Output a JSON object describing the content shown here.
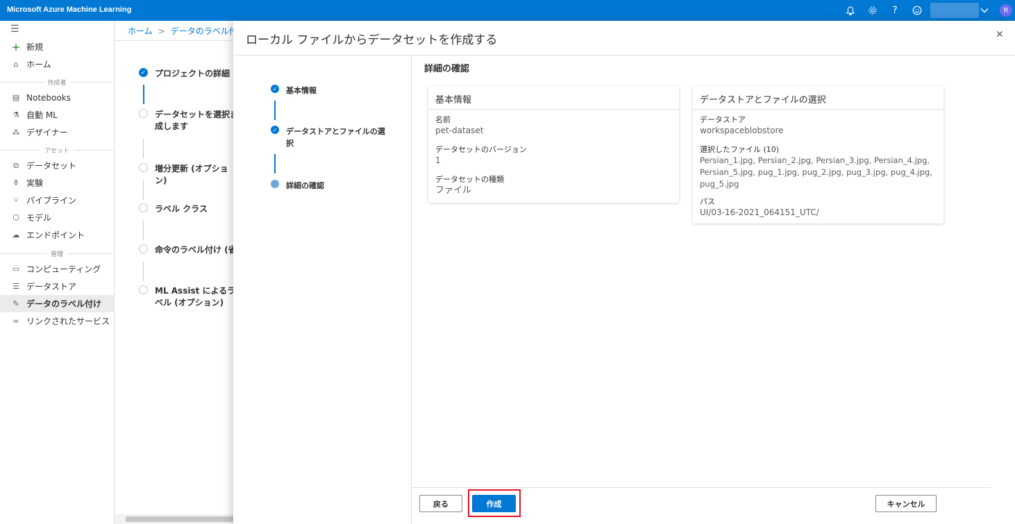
{
  "app": {
    "title": "Microsoft Azure Machine Learning",
    "topbar_icons": [
      "bell-icon",
      "gear-icon",
      "help-icon",
      "smiley-icon",
      "chevron-down-icon"
    ],
    "help_glyph": "?",
    "avatar_initial": "R",
    "colors": {
      "accent": "#0078d4",
      "highlight": "#e81123"
    }
  },
  "sidebar": {
    "new_label": "新規",
    "home_label": "ホーム",
    "section_author": "作成者",
    "notebooks_label": "Notebooks",
    "automl_label": "自動 ML",
    "designer_label": "デザイナー",
    "section_assets": "アセット",
    "datasets_label": "データセット",
    "experiments_label": "実験",
    "pipelines_label": "パイプライン",
    "models_label": "モデル",
    "endpoints_label": "エンドポイント",
    "section_manage": "管理",
    "compute_label": "コンピューティング",
    "datastores_label": "データストア",
    "labeling_label": "データのラベル付け",
    "linked_services_label": "リンクされたサービス"
  },
  "background": {
    "breadcrumb_home": "ホーム",
    "breadcrumb_sep": ">",
    "breadcrumb_current": "データのラベル付け",
    "steps": [
      "プロジェクトの詳細",
      "データセットを選択ま 成します",
      "増分更新 (オプション)",
      "ラベル クラス",
      "命令のラベル付け (省",
      "ML Assist によるラベル (オプション)"
    ]
  },
  "panel": {
    "title": "ローカル ファイルからデータセットを作成する",
    "close_glyph": "✕",
    "wizard_steps": [
      "基本情報",
      "データストアとファイルの選択",
      "詳細の確認"
    ],
    "review_title": "詳細の確認",
    "basic_card": {
      "title": "基本情報",
      "name_label": "名前",
      "name_value": "pet-dataset",
      "version_label": "データセットのバージョン",
      "version_value": "1",
      "type_label": "データセットの種類",
      "type_value": "ファイル"
    },
    "datastore_card": {
      "title": "データストアとファイルの選択",
      "datastore_label": "データストア",
      "datastore_value": "workspaceblobstore",
      "files_label": "選択したファイル (10)",
      "files_line1": "Persian_1.jpg, Persian_2.jpg, Persian_3.jpg, Persian_4.jpg,",
      "files_line2": "Persian_5.jpg, pug_1.jpg, pug_2.jpg, pug_3.jpg, pug_4.jpg,",
      "files_line3": "pug_5.jpg",
      "path_label": "パス",
      "path_value": "UI/03-16-2021_064151_UTC/"
    },
    "buttons": {
      "back": "戻る",
      "create": "作成",
      "cancel": "キャンセル"
    }
  }
}
